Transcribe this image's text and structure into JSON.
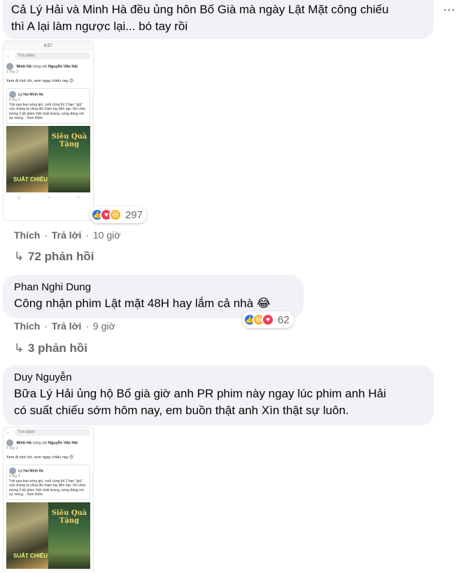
{
  "comment1": {
    "text": "Cả Lý Hải và Minh Hà đều ủng hôn Bố Già mà ngày Lật Mặt công chiếu thì A lại làm ngược lại... bó tay rồi",
    "line1": "Cả Lý Hải và Minh Hà đều ủng hôn Bố Già mà ngày Lật Mặt công chiếu",
    "line2": "thì A lại làm ngược lại... bó tay rồi",
    "more_icon": "more-dots-icon",
    "reactions": {
      "icons": [
        "like",
        "love",
        "haha"
      ],
      "count": "297"
    },
    "actions": {
      "like": "Thích",
      "reply": "Trả lời",
      "time": "10 giờ"
    },
    "replies": "72 phản hồi"
  },
  "comment2": {
    "author": "Phan Nghi Dung",
    "text": "Công nhận phim Lật mặt 48H hay lắm cả nhà 😂",
    "reactions": {
      "icons": [
        "like",
        "haha",
        "love"
      ],
      "count": "62"
    },
    "actions": {
      "like": "Thích",
      "reply": "Trả lời",
      "time": "9 giờ"
    },
    "replies": "3 phản hồi"
  },
  "comment3": {
    "author": "Duy Nguyễn",
    "line1": "Bữa Lý Hải ủng hộ Bố già giờ anh PR phim này ngay lúc phim anh Hải",
    "line2": "có suất chiếu sớm hôm nay, em buồn thật anh Xìn thật sự luôn."
  },
  "screenshot": {
    "search_placeholder": "Tìm kiếm",
    "poster_author": "Minh Hà",
    "with_label": "cùng với",
    "poster_tag": "Nguyễn Văn Hải",
    "post_time": "5 thg 3",
    "post_text": "Xem đi chờ chi, xem ngay chiếu nay 😊",
    "shared_author": "Lý Hai Minh Ha",
    "shared_time": "5 thg 3",
    "shared_text": "Trải qua bao sóng gió, cuối cùng thì 2 bạn \"già\" của chúng ta cũng đã chạm tay đến rạp. Xin chúc mừng 2 bộ phim Việt chất lượng, xứng đáng với sự mong... Xem thêm",
    "poster_left_text": "SUẤT CHIẾU",
    "poster_right_text": "Siêu Quà Tặng"
  },
  "colors": {
    "bubble": "#f0f2f5",
    "secondary_text": "#65676b",
    "like": "#1877f2",
    "love": "#f33e58",
    "haha": "#f7b125"
  }
}
